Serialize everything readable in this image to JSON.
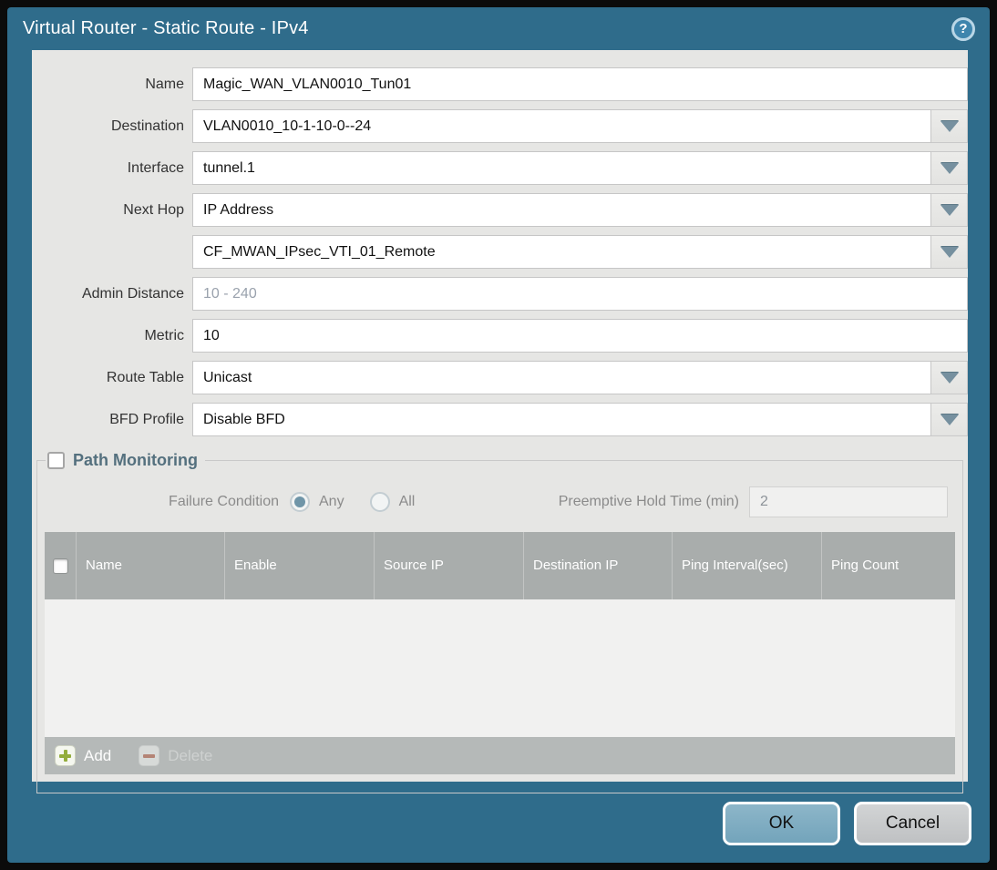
{
  "titlebar": {
    "title": "Virtual Router - Static Route - IPv4",
    "help_icon": "?"
  },
  "form": {
    "name": {
      "label": "Name",
      "value": "Magic_WAN_VLAN0010_Tun01"
    },
    "destination": {
      "label": "Destination",
      "value": "VLAN0010_10-1-10-0--24"
    },
    "interface": {
      "label": "Interface",
      "value": "tunnel.1"
    },
    "next_hop": {
      "label": "Next Hop",
      "value": "IP Address"
    },
    "next_hop_address": {
      "value": "CF_MWAN_IPsec_VTI_01_Remote"
    },
    "admin_distance": {
      "label": "Admin Distance",
      "placeholder": "10 - 240",
      "value": ""
    },
    "metric": {
      "label": "Metric",
      "value": "10"
    },
    "route_table": {
      "label": "Route Table",
      "value": "Unicast"
    },
    "bfd_profile": {
      "label": "BFD Profile",
      "value": "Disable BFD"
    }
  },
  "path_monitoring": {
    "title": "Path Monitoring",
    "enabled": false,
    "failure_condition": {
      "label": "Failure Condition",
      "options": [
        {
          "label": "Any",
          "selected": true
        },
        {
          "label": "All",
          "selected": false
        }
      ]
    },
    "preemptive_hold_time": {
      "label": "Preemptive Hold Time (min)",
      "value": "2"
    },
    "table": {
      "headers": [
        "Name",
        "Enable",
        "Source IP",
        "Destination IP",
        "Ping Interval(sec)",
        "Ping Count"
      ],
      "rows": []
    },
    "toolbar": {
      "add": "Add",
      "delete": "Delete"
    }
  },
  "footer": {
    "ok": "OK",
    "cancel": "Cancel"
  },
  "colors": {
    "accent_teal": "#2f6c8b",
    "content_bg": "#e6e6e4",
    "table_header_gray": "#a9adac",
    "ok_button": "#7dadc3",
    "cancel_button": "#c8cacc",
    "add_plus_green": "#93ad3c",
    "delete_minus_red": "#b4735f",
    "pm_title": "#54707e"
  }
}
